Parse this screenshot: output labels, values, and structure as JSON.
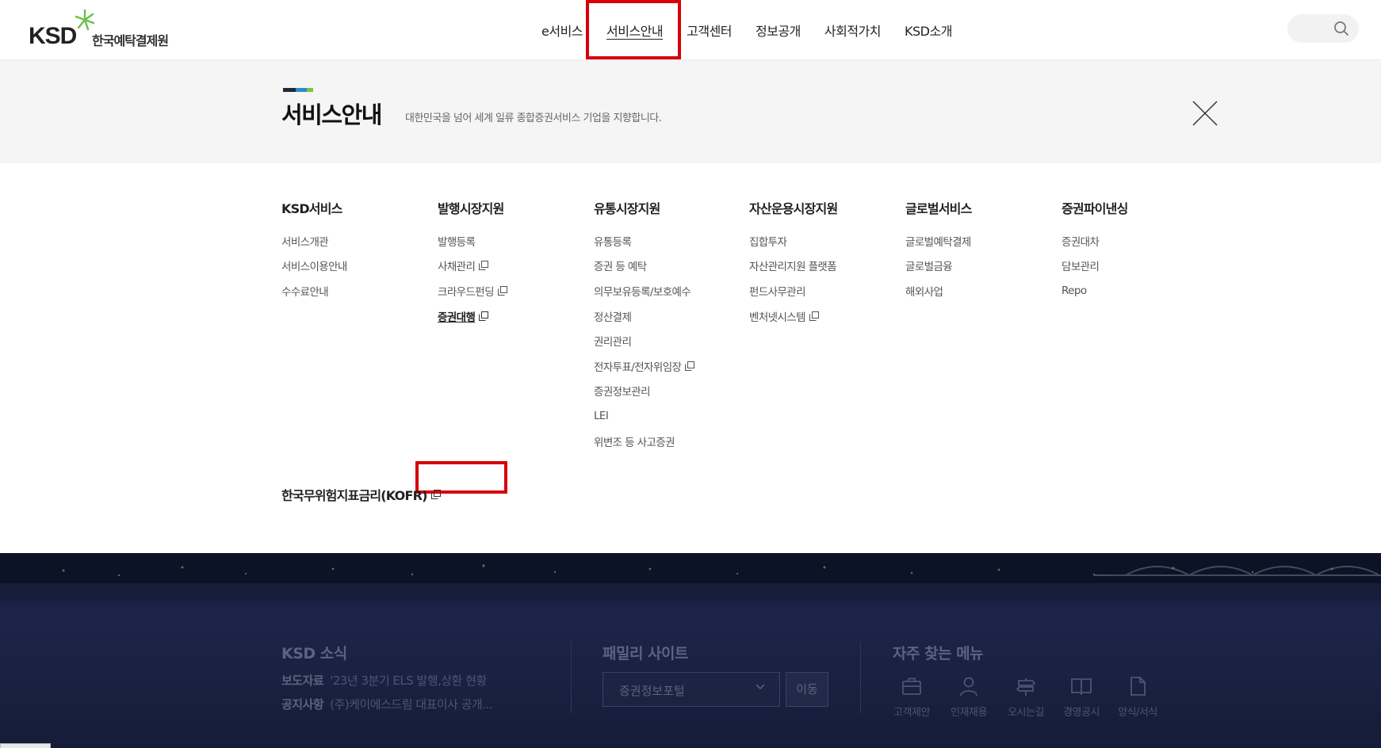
{
  "header": {
    "logo_text": "KSD",
    "logo_kor": "한국예탁결제원",
    "nav": [
      {
        "label": "e서비스"
      },
      {
        "label": "서비스안내"
      },
      {
        "label": "고객센터"
      },
      {
        "label": "정보공개"
      },
      {
        "label": "사회적가치"
      },
      {
        "label": "KSD소개"
      }
    ]
  },
  "title_band": {
    "title": "서비스안내",
    "description": "대한민국을 넘어 세계 일류 종합증권서비스 기업을 지향합니다."
  },
  "menu": {
    "columns": [
      {
        "title": "KSD서비스",
        "items": [
          {
            "label": "서비스개관"
          },
          {
            "label": "서비스이용안내"
          },
          {
            "label": "수수료안내"
          }
        ]
      },
      {
        "title": "발행시장지원",
        "items": [
          {
            "label": "발행등록"
          },
          {
            "label": "사채관리"
          },
          {
            "label": "크라우드펀딩"
          },
          {
            "label": "증권대행"
          }
        ]
      },
      {
        "title": "유통시장지원",
        "items": [
          {
            "label": "유통등록"
          },
          {
            "label": "증권 등 예탁"
          },
          {
            "label": "의무보유등록/보호예수"
          },
          {
            "label": "정산결제"
          },
          {
            "label": "권리관리"
          },
          {
            "label": "전자투표/전자위임장"
          },
          {
            "label": "증권정보관리"
          },
          {
            "label": "LEI"
          },
          {
            "label": "위변조 등 사고증권"
          }
        ]
      },
      {
        "title": "자산운용시장지원",
        "items": [
          {
            "label": "집합투자"
          },
          {
            "label": "자산관리지원 플랫폼"
          },
          {
            "label": "펀드사무관리"
          },
          {
            "label": "벤처넷시스템"
          }
        ]
      },
      {
        "title": "글로벌서비스",
        "items": [
          {
            "label": "글로벌예탁결제"
          },
          {
            "label": "글로벌금융"
          },
          {
            "label": "해외사업"
          }
        ]
      },
      {
        "title": "증권파이낸싱",
        "items": [
          {
            "label": "증권대차"
          },
          {
            "label": "담보관리"
          },
          {
            "label": "Repo"
          }
        ]
      }
    ],
    "extra_link": "한국무위험지표금리(KOFR)"
  },
  "footer": {
    "news_title": "KSD 소식",
    "news": [
      {
        "category": "보도자료",
        "text": "'23년 3분기 ELS 발행,상환 현황"
      },
      {
        "category": "공지사항",
        "text": "(주)케이에스드림 대표이사 공개..."
      }
    ],
    "family_title": "패밀리 사이트",
    "family_selected": "증권정보포털",
    "family_go": "이동",
    "quick_title": "자주 찾는 메뉴",
    "quick": [
      {
        "label": "고객제안",
        "icon": "briefcase-icon"
      },
      {
        "label": "인재채용",
        "icon": "person-icon"
      },
      {
        "label": "오시는길",
        "icon": "signpost-icon"
      },
      {
        "label": "경영공시",
        "icon": "book-icon"
      },
      {
        "label": "양식/서식",
        "icon": "document-icon"
      }
    ]
  },
  "colors": {
    "highlight": "#d6000a",
    "brand_green": "#6cc04a",
    "title_bar": [
      "#1e2a3a",
      "#2a8cc9",
      "#7cc242"
    ]
  }
}
